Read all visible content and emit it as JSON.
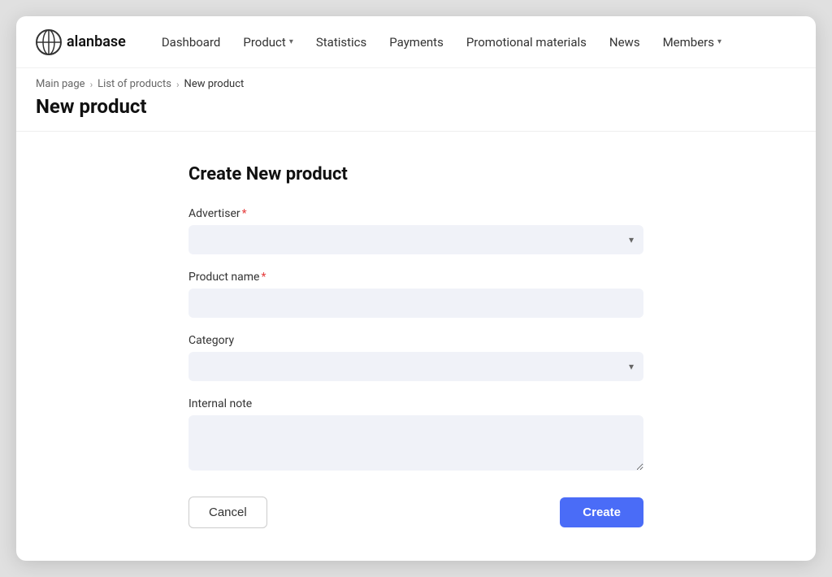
{
  "logo": {
    "text": "alanbase"
  },
  "nav": {
    "items": [
      {
        "label": "Dashboard",
        "hasDropdown": false
      },
      {
        "label": "Product",
        "hasDropdown": true
      },
      {
        "label": "Statistics",
        "hasDropdown": false
      },
      {
        "label": "Payments",
        "hasDropdown": false
      },
      {
        "label": "Promotional materials",
        "hasDropdown": false
      },
      {
        "label": "News",
        "hasDropdown": false
      },
      {
        "label": "Members",
        "hasDropdown": true
      }
    ]
  },
  "breadcrumb": {
    "items": [
      {
        "label": "Main page"
      },
      {
        "label": "List of products"
      },
      {
        "label": "New product"
      }
    ]
  },
  "page_title": "New product",
  "form": {
    "title": "Create New product",
    "fields": {
      "advertiser_label": "Advertiser",
      "advertiser_required": "*",
      "product_name_label": "Product name",
      "product_name_required": "*",
      "category_label": "Category",
      "internal_note_label": "Internal note"
    },
    "buttons": {
      "cancel": "Cancel",
      "create": "Create"
    }
  }
}
